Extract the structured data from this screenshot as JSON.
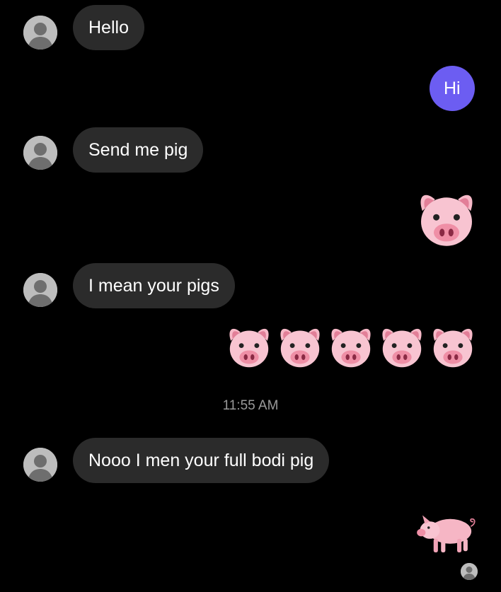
{
  "colors": {
    "background": "#000000",
    "incoming_bubble": "#2b2b2b",
    "outgoing_bubble": "#6c5df2",
    "timestamp_text": "#9a9a9a",
    "avatar": "#bdbdbd"
  },
  "messages": [
    {
      "direction": "incoming",
      "text": "Hello",
      "avatar_icon": "person-avatar-icon"
    },
    {
      "direction": "outgoing",
      "text": "Hi"
    },
    {
      "direction": "incoming",
      "text": "Send me pig",
      "avatar_icon": "person-avatar-icon"
    },
    {
      "direction": "outgoing",
      "emoji": [
        "pig-face-emoji"
      ]
    },
    {
      "direction": "incoming",
      "text": "I mean your pigs",
      "avatar_icon": "person-avatar-icon"
    },
    {
      "direction": "outgoing",
      "emoji": [
        "pig-face-emoji",
        "pig-face-emoji",
        "pig-face-emoji",
        "pig-face-emoji",
        "pig-face-emoji"
      ]
    },
    {
      "direction": "incoming",
      "text": "Nooo I men your full bodi pig",
      "avatar_icon": "person-avatar-icon"
    },
    {
      "direction": "outgoing",
      "emoji": [
        "pig-emoji"
      ]
    }
  ],
  "timestamp": "11:55 AM",
  "read_receipt_icon": "read-receipt-avatar-icon"
}
